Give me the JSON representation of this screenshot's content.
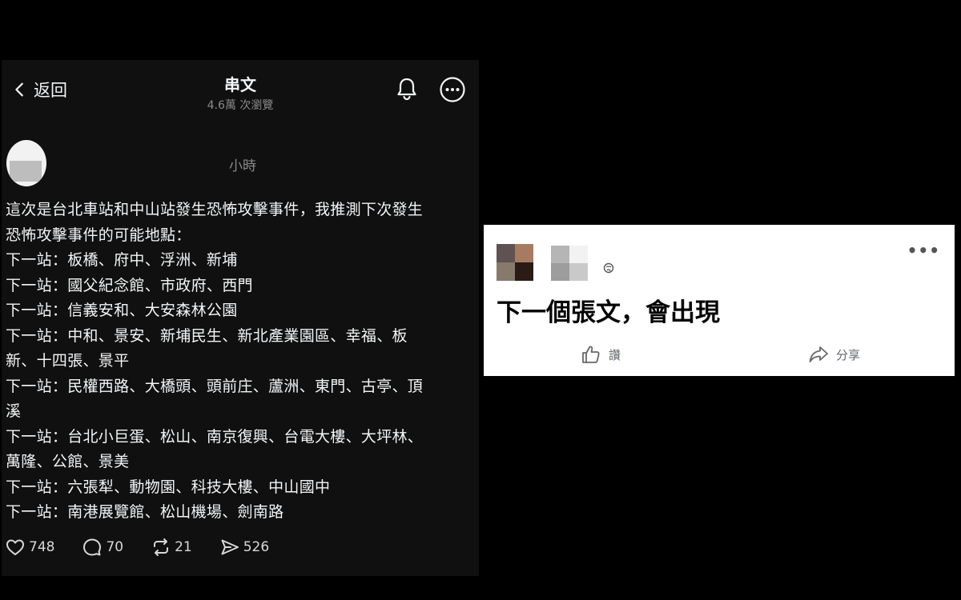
{
  "threads": {
    "back_label": "返回",
    "title": "串文",
    "views": "4.6萬 次瀏覽",
    "time": "小時",
    "body_lines": [
      "這次是台北車站和中山站發生恐怖攻擊事件，我推測下次發生",
      "恐怖攻擊事件的可能地點：",
      "下一站：板橋、府中、浮洲、新埔",
      "下一站：國父紀念館、市政府、西門",
      "下一站：信義安和、大安森林公園",
      "下一站：中和、景安、新埔民生、新北產業園區、幸福、板",
      "新、十四張、景平",
      "下一站：民權西路、大橋頭、頭前庄、蘆洲、東門、古亭、頂",
      "溪",
      "下一站：台北小巨蛋、松山、南京復興、台電大樓、大坪林、",
      "萬隆、公館、景美",
      "下一站：六張犁、動物園、科技大樓、中山國中",
      "下一站：南港展覽館、松山機場、劍南路"
    ],
    "stats": {
      "likes": "748",
      "comments": "70",
      "reposts": "21",
      "shares": "526"
    },
    "icons": [
      "chevron-left-icon",
      "bell-icon",
      "more-icon",
      "heart-icon",
      "comment-icon",
      "repost-icon",
      "send-icon"
    ]
  },
  "facebook": {
    "post_text": "下一個張文，會出現",
    "like_label": "讚",
    "share_label": "分享",
    "more_label": "•••",
    "icons": [
      "thumbs-up-icon",
      "share-arrow-icon",
      "globe-icon"
    ]
  },
  "colors": {
    "threads_bg": "#101010",
    "page_bg": "#000000",
    "facebook_bg": "#ffffff",
    "muted_text": "#8a8a8a"
  }
}
